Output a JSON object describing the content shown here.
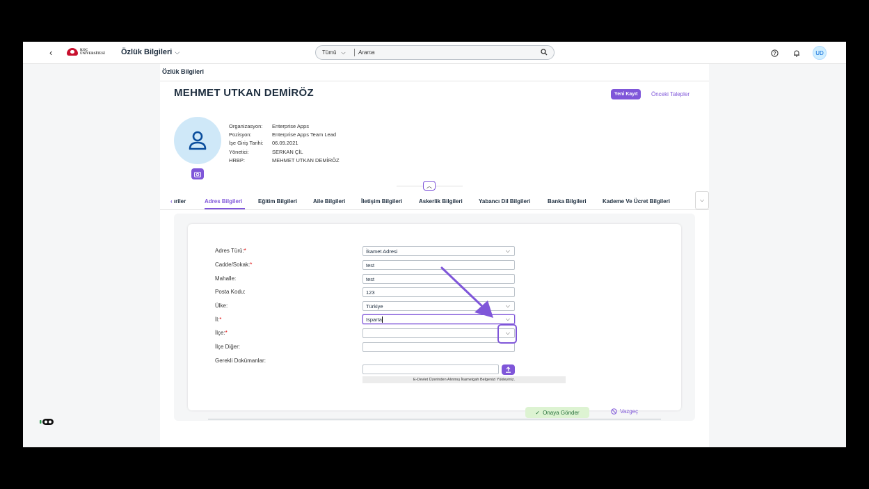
{
  "shell": {
    "back_icon": "chevron-left-icon",
    "logo_line1": "KOÇ",
    "logo_line2": "ÜNİVERSİTESİ",
    "app_title": "Özlük Bilgileri",
    "search_scope": "Tümü",
    "search_placeholder": "Arama",
    "avatar_initials": "UD"
  },
  "page": {
    "title": "Özlük Bilgileri",
    "employee_name": "MEHMET UTKAN DEMİRÖZ",
    "new_record_button": "Yeni Kayıt",
    "previous_requests_link": "Önceki Talepler"
  },
  "employee_info": [
    {
      "label": "Organizasyon:",
      "value": "Enterprise Apps"
    },
    {
      "label": "Pozisyon:",
      "value": "Enterprise Apps Team Lead"
    },
    {
      "label": "İşe Giriş Tarihi:",
      "value": "06.09.2021"
    },
    {
      "label": "Yönetici:",
      "value": "SERKAN ÇİL"
    },
    {
      "label": "HRBP:",
      "value": "MEHMET UTKAN DEMİRÖZ"
    }
  ],
  "tabs": {
    "partial": "ıriler",
    "items": [
      "Adres Bilgileri",
      "Eğitim Bilgileri",
      "Aile Bilgileri",
      "İletişim Bilgileri",
      "Askerlik Bilgileri",
      "Yabancı Dil Bilgileri",
      "Banka Bilgileri",
      "Kademe Ve Ücret Bilgileri"
    ],
    "active": "Adres Bilgileri"
  },
  "form": {
    "labels": {
      "adres_turu": "Adres Türü:",
      "cadde": "Cadde/Sokak:",
      "mahalle": "Mahalle:",
      "posta": "Posta Kodu:",
      "ulke": "Ülke:",
      "il": "İl:",
      "ilce": "İlçe:",
      "ilce_diger": "İlçe Diğer:",
      "dokumanlar": "Gerekli Dokümanlar:"
    },
    "required_mark": "*",
    "values": {
      "adres_turu": "İkamet Adresi",
      "cadde": "test",
      "mahalle": "test",
      "posta": "123",
      "ulke": "Türkiye",
      "il": "Isparta",
      "ilce": "",
      "ilce_diger": "",
      "dokuman": ""
    },
    "hint": "E-Devlet Üzerinden Alınmış İkametgah Belgenizi Yükleyiniz.",
    "submit_button": "Onaya Gönder",
    "cancel_button": "Vazgeç"
  },
  "colors": {
    "accent": "#7f56d9",
    "success_bg": "#ddf3d2",
    "brand_red": "#c8102e"
  }
}
